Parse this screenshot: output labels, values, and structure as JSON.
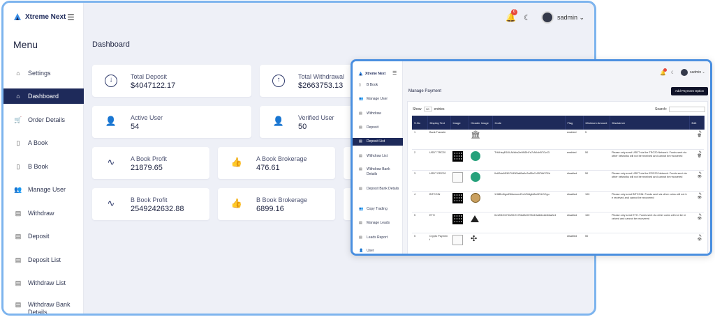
{
  "app": {
    "brand": "Xtreme Next"
  },
  "back_window": {
    "menu_title": "Menu",
    "sidebar": [
      {
        "label": "Settings",
        "icon": "home-icon"
      },
      {
        "label": "Dashboard",
        "icon": "home-icon",
        "active": true
      },
      {
        "label": "Order Details",
        "icon": "cart-icon"
      },
      {
        "label": "A Book",
        "icon": "book-icon"
      },
      {
        "label": "B Book",
        "icon": "book-icon"
      },
      {
        "label": "Manage User",
        "icon": "users-icon"
      },
      {
        "label": "Withdraw",
        "icon": "archive-icon"
      },
      {
        "label": "Deposit",
        "icon": "archive-icon"
      },
      {
        "label": "Deposit List",
        "icon": "archive-icon"
      },
      {
        "label": "Withdraw List",
        "icon": "archive-icon"
      },
      {
        "label": "Withdraw Bank Details",
        "icon": "archive-icon"
      }
    ],
    "header": {
      "notification_count": "0",
      "username": "sadmin"
    },
    "page_title": "Dashboard",
    "cards": [
      {
        "label": "Total Deposit",
        "value": "$4047122.17",
        "icon": "arrow-down-circle-icon"
      },
      {
        "label": "Total Withdrawal",
        "value": "$2663753.13",
        "icon": "arrow-up-circle-icon"
      },
      {
        "label": "Active User",
        "value": "54",
        "icon": "user-icon"
      },
      {
        "label": "Verified User",
        "value": "50",
        "icon": "user-check-icon"
      },
      {
        "label": "A Book Profit",
        "value": "21879.65",
        "icon": "activity-icon"
      },
      {
        "label": "A Book Brokerage",
        "value": "476.61",
        "icon": "thumbs-up-icon"
      },
      {
        "label": "B Book Profit",
        "value": "2549242632.88",
        "icon": "activity-icon"
      },
      {
        "label": "B Book Brokerage",
        "value": "6899.16",
        "icon": "thumbs-up-icon"
      }
    ]
  },
  "front_window": {
    "sidebar": [
      {
        "label": "B Book"
      },
      {
        "label": "Manage User"
      },
      {
        "label": "Withdraw"
      },
      {
        "label": "Deposit"
      },
      {
        "label": "Deposit List",
        "active": true
      },
      {
        "label": "Withdraw List"
      },
      {
        "label": "Withdraw Bank Details"
      },
      {
        "label": "Deposit Bank Details"
      },
      {
        "label": "Copy Trading"
      },
      {
        "label": "Manage Leads"
      },
      {
        "label": "Leads Report"
      },
      {
        "label": "User"
      }
    ],
    "header": {
      "username": "sadmin"
    },
    "page_title": "Manage Payment",
    "add_button": "Add Payment Option",
    "show_label": "Show",
    "show_value": "50",
    "entries_label": "entries",
    "search_label": "Search:",
    "columns": [
      "S.No",
      "Display Text",
      "Image",
      "Header Image",
      "Code",
      "Flag",
      "Minimum Amount",
      "Disclaimer",
      "Edit"
    ],
    "rows": [
      {
        "sno": "1",
        "text": "Bank Transfer",
        "image": "none",
        "header": "bank-icon",
        "code": "",
        "flag": "enabled",
        "min": "5",
        "disclaimer": ""
      },
      {
        "sno": "2",
        "text": "USDT TRC20",
        "image": "qr",
        "header": "usdt-icon",
        "code": "TH4HeyE6XLAkWw2eHNDhFa7rAKxhB7GzJ3",
        "flag": "enabled",
        "min": "50",
        "disclaimer": "Please only send USDT via the TRC20 Network. Funds sent via other networks will not be received and cannot be recovered"
      },
      {
        "sno": "3",
        "text": "USDT ERC20",
        "image": "placeholder",
        "header": "usdt-icon",
        "code": "0x62de6f2617043f5a80a0a7a85e7c0578d702d",
        "flag": "disabled",
        "min": "50",
        "disclaimer": "Please only send USDT via the ERC20 Network. Funds sent via other networks will not be received and cannot be recovered"
      },
      {
        "sno": "4",
        "text": "BITCOIN",
        "image": "qr",
        "header": "btc-icon",
        "code": "1H6Bm5gmD6bwrunvEmV9fdgbMmMVLDCgu",
        "flag": "disabled",
        "min": "100",
        "disclaimer": "Please only send BITCOIN. Funds sent via other coins will not be received and cannot be recovered"
      },
      {
        "sno": "5",
        "text": "ETH",
        "image": "qr",
        "header": "eth-icon",
        "code": "0x120b9173120b7e75bd9e0076e19a6bbdcb6ba2e4",
        "flag": "disabled",
        "min": "100",
        "disclaimer": "Please only send ETH. Funds sent via other coins will not be received and cannot be recovered"
      },
      {
        "sno": "5",
        "text": "Crypto Payment",
        "image": "placeholder",
        "header": "knot-icon",
        "code": "",
        "flag": "disabled",
        "min": "50",
        "disclaimer": ""
      }
    ]
  },
  "colors": {
    "sidebar_active": "#1e2a5a",
    "window_border": "#7db4ee",
    "enabled": "#2e9c4a",
    "disabled": "#d23b3b"
  }
}
